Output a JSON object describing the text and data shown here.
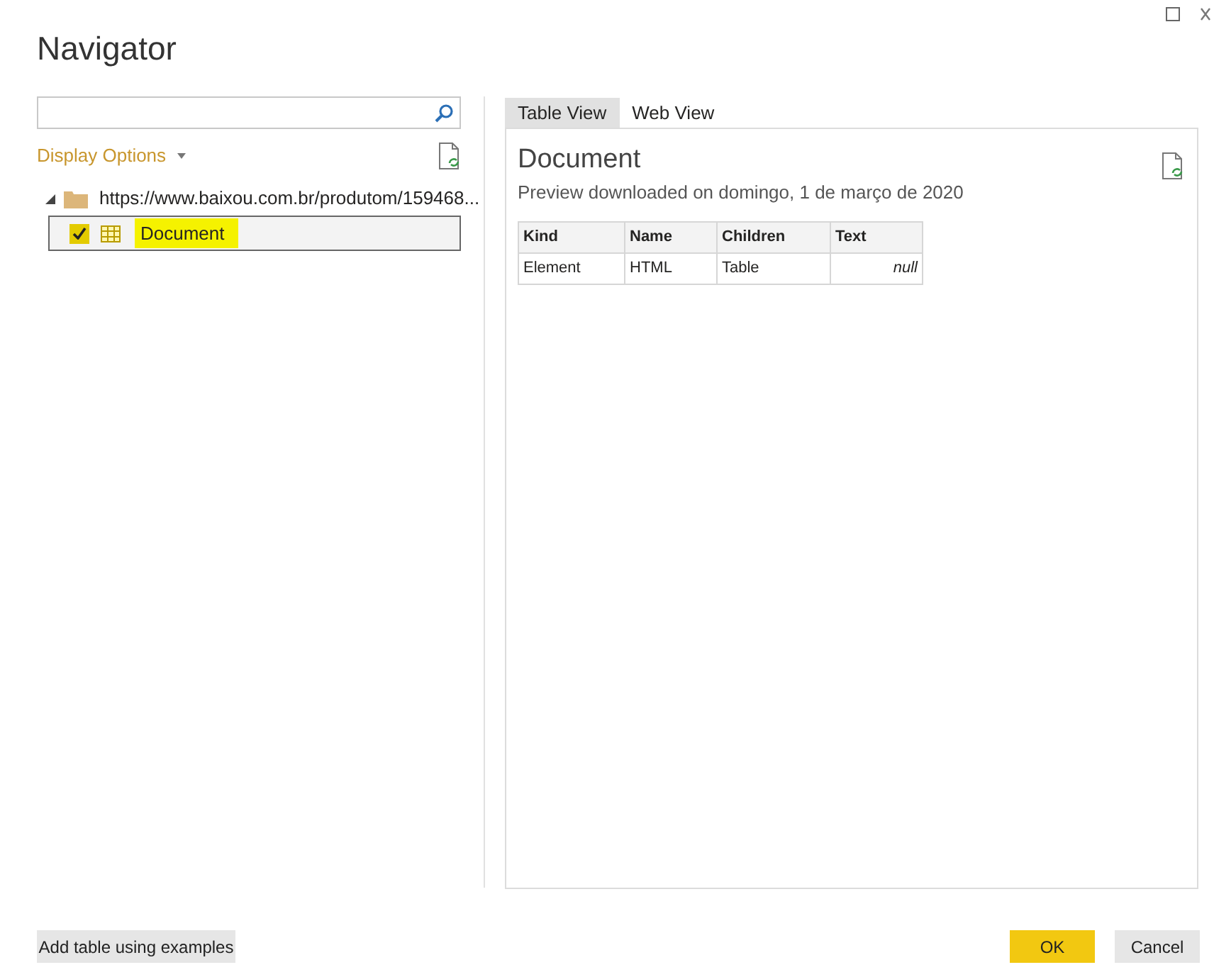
{
  "window": {
    "title": "Navigator"
  },
  "display_options": {
    "label": "Display Options"
  },
  "tree": [
    {
      "label": "https://www.baixou.com.br/produtom/159468...",
      "expanded": true,
      "children": [
        {
          "label": "Document",
          "checked": true,
          "selected": true,
          "highlighted": true
        }
      ]
    }
  ],
  "tabs": [
    {
      "label": "Table View",
      "selected": true
    },
    {
      "label": "Web View",
      "selected": false
    }
  ],
  "preview": {
    "title": "Document",
    "subtitle": "Preview downloaded on domingo, 1 de março de 2020",
    "columns": [
      "Kind",
      "Name",
      "Children",
      "Text"
    ],
    "rows": [
      [
        {
          "text": "Element"
        },
        {
          "text": "HTML"
        },
        {
          "text": "Table"
        },
        {
          "text": "null",
          "kind": "null"
        }
      ]
    ]
  },
  "buttons": [
    {
      "label": "Add table using examples",
      "kind": "secondary"
    },
    {
      "label": "OK",
      "kind": "primary"
    },
    {
      "label": "Cancel",
      "kind": "secondary"
    }
  ]
}
